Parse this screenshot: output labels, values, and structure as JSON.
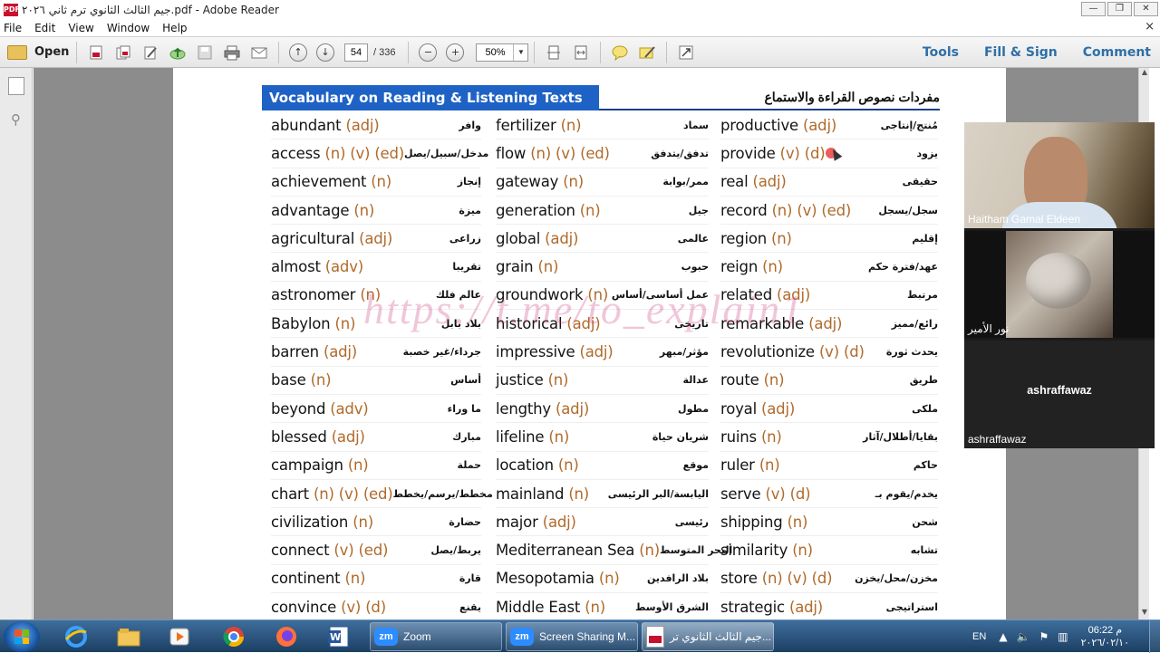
{
  "window": {
    "title": "جيم الثالث الثانوي ترم ثاني ٢٠٢٦.pdf - Adobe Reader",
    "app_icon_text": "PDF",
    "minimize": "—",
    "restore": "❐",
    "close": "✕"
  },
  "menu": [
    "File",
    "Edit",
    "View",
    "Window",
    "Help"
  ],
  "menu_close": "×",
  "toolbar": {
    "open_label": "Open",
    "page_current": "54",
    "page_total": "/ 336",
    "zoom_value": "50%",
    "zoom_minus": "−",
    "zoom_plus": "+",
    "prev_page": "↑",
    "next_page": "↓",
    "dropdown_arrow": "▼",
    "right": {
      "tools": "Tools",
      "fill_sign": "Fill & Sign",
      "comment": "Comment"
    }
  },
  "document": {
    "header_en": "Vocabulary on Reading & Listening Texts",
    "header_ar": "مفردات نصوص القراءة والاستماع",
    "watermark": "https://t.me/to_explain1",
    "columns": [
      [
        {
          "word": "abundant",
          "pos": "(adj)",
          "ar": "وافر"
        },
        {
          "word": "access",
          "pos": "(n) (v) (ed)",
          "ar": "مدخل/سبيل/يصل"
        },
        {
          "word": "achievement",
          "pos": "(n)",
          "ar": "إنجاز"
        },
        {
          "word": "advantage",
          "pos": "(n)",
          "ar": "ميزة"
        },
        {
          "word": "agricultural",
          "pos": "(adj)",
          "ar": "زراعى"
        },
        {
          "word": "almost",
          "pos": "(adv)",
          "ar": "تقريبا"
        },
        {
          "word": "astronomer",
          "pos": "(n)",
          "ar": "عالم فلك"
        },
        {
          "word": "Babylon",
          "pos": "(n)",
          "ar": "بلاد بابل"
        },
        {
          "word": "barren",
          "pos": "(adj)",
          "ar": "جرداء/غير خصبة"
        },
        {
          "word": "base",
          "pos": "(n)",
          "ar": "أساس"
        },
        {
          "word": "beyond",
          "pos": "(adv)",
          "ar": "ما وراء"
        },
        {
          "word": "blessed",
          "pos": "(adj)",
          "ar": "مبارك"
        },
        {
          "word": "campaign",
          "pos": "(n)",
          "ar": "حملة"
        },
        {
          "word": "chart",
          "pos": "(n) (v) (ed)",
          "ar": "مخطط/يرسم/يخطط"
        },
        {
          "word": "civilization",
          "pos": "(n)",
          "ar": "حضارة"
        },
        {
          "word": "connect",
          "pos": "(v) (ed)",
          "ar": "يربط/يصل"
        },
        {
          "word": "continent",
          "pos": "(n)",
          "ar": "قارة"
        },
        {
          "word": "convince",
          "pos": "(v) (d)",
          "ar": "يقنع"
        }
      ],
      [
        {
          "word": "fertilizer",
          "pos": "(n)",
          "ar": "سماد"
        },
        {
          "word": "flow",
          "pos": "(n) (v) (ed)",
          "ar": "تدفق/يتدفق"
        },
        {
          "word": "gateway",
          "pos": "(n)",
          "ar": "ممر/بوابة"
        },
        {
          "word": "generation",
          "pos": "(n)",
          "ar": "جيل"
        },
        {
          "word": "global",
          "pos": "(adj)",
          "ar": "عالمى"
        },
        {
          "word": "grain",
          "pos": "(n)",
          "ar": "حبوب"
        },
        {
          "word": "groundwork",
          "pos": "(n)",
          "ar": "عمل أساسى/أساس"
        },
        {
          "word": "historical",
          "pos": "(adj)",
          "ar": "تاريخى"
        },
        {
          "word": "impressive",
          "pos": "(adj)",
          "ar": "مؤثر/مبهر"
        },
        {
          "word": "justice",
          "pos": "(n)",
          "ar": "عدالة"
        },
        {
          "word": "lengthy",
          "pos": "(adj)",
          "ar": "مطول"
        },
        {
          "word": "lifeline",
          "pos": "(n)",
          "ar": "شريان حياة"
        },
        {
          "word": "location",
          "pos": "(n)",
          "ar": "موقع"
        },
        {
          "word": "mainland",
          "pos": "(n)",
          "ar": "اليابسة/البر الرئيسى"
        },
        {
          "word": "major",
          "pos": "(adj)",
          "ar": "رئيسى"
        },
        {
          "word": "Mediterranean Sea",
          "pos": "(n)",
          "ar": "البحر المتوسط"
        },
        {
          "word": "Mesopotamia",
          "pos": "(n)",
          "ar": "بلاد الرافدين"
        },
        {
          "word": "Middle East",
          "pos": "(n)",
          "ar": "الشرق الأوسط"
        }
      ],
      [
        {
          "word": "productive",
          "pos": "(adj)",
          "ar": "مُنتج/إنتاجى"
        },
        {
          "word": "provide",
          "pos": "(v) (d)",
          "ar": "يزود"
        },
        {
          "word": "real",
          "pos": "(adj)",
          "ar": "حقيقى"
        },
        {
          "word": "record",
          "pos": "(n) (v) (ed)",
          "ar": "سجل/يسجل"
        },
        {
          "word": "region",
          "pos": "(n)",
          "ar": "إقليم"
        },
        {
          "word": "reign",
          "pos": "(n)",
          "ar": "عهد/فترة حكم"
        },
        {
          "word": "related",
          "pos": "(adj)",
          "ar": "مرتبط"
        },
        {
          "word": "remarkable",
          "pos": "(adj)",
          "ar": "رائع/مميز"
        },
        {
          "word": "revolutionize",
          "pos": "(v) (d)",
          "ar": "يحدث ثورة"
        },
        {
          "word": "route",
          "pos": "(n)",
          "ar": "طريق"
        },
        {
          "word": "royal",
          "pos": "(adj)",
          "ar": "ملكى"
        },
        {
          "word": "ruins",
          "pos": "(n)",
          "ar": "بقايا/أطلال/آثار"
        },
        {
          "word": "ruler",
          "pos": "(n)",
          "ar": "حاكم"
        },
        {
          "word": "serve",
          "pos": "(v) (d)",
          "ar": "يخدم/يقوم بـ"
        },
        {
          "word": "shipping",
          "pos": "(n)",
          "ar": "شحن"
        },
        {
          "word": "similarity",
          "pos": "(n)",
          "ar": "تشابه"
        },
        {
          "word": "store",
          "pos": "(n) (v) (d)",
          "ar": "مخزن/محل/يخزن"
        },
        {
          "word": "strategic",
          "pos": "(adj)",
          "ar": "استراتيجى"
        }
      ]
    ]
  },
  "video_panel": {
    "tile1_name": "Haitham Gamal Eldeen",
    "tile2_name": "نور الأمير",
    "tile3_center": "ashraffawaz",
    "tile3_name": "ashraffawaz"
  },
  "taskbar": {
    "tasks": [
      {
        "label": "Zoom",
        "logo": "zm"
      },
      {
        "label": "Screen Sharing M...",
        "logo": "zm"
      },
      {
        "label": "جيم الثالث الثانوي تر..."
      }
    ],
    "lang": "EN",
    "time": "06:22 م",
    "date": "٢٠٢٦/٠٢/١٠"
  },
  "colors": {
    "header_blue": "#1f62c5",
    "pos_orange": "#b06a2a",
    "tools_blue": "#2e6fa7"
  }
}
